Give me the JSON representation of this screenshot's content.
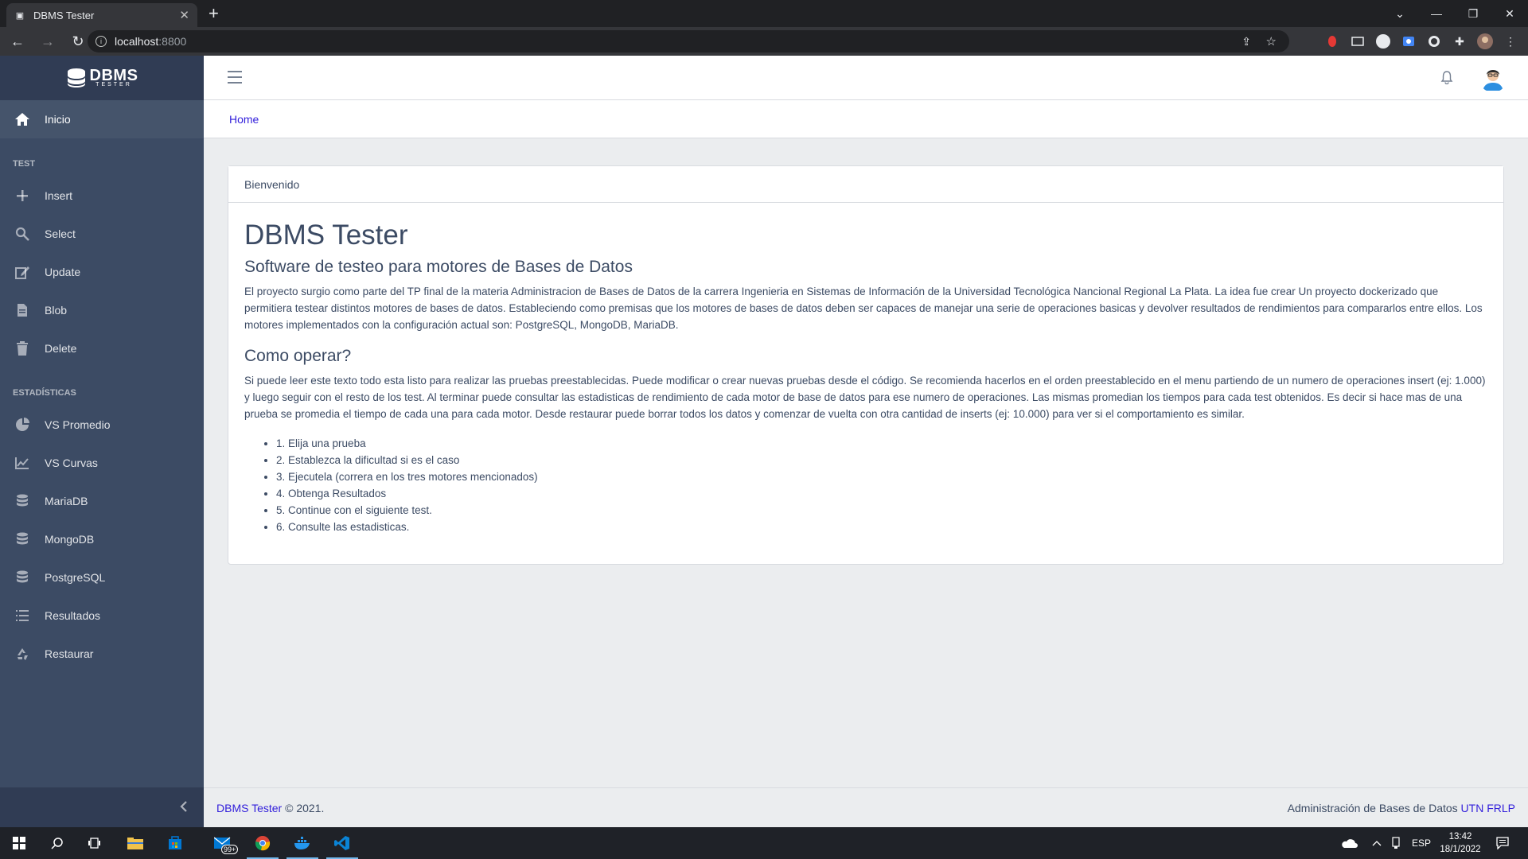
{
  "browser": {
    "tab_title": "DBMS Tester",
    "url_host": "localhost",
    "url_port": ":8800"
  },
  "brand": {
    "name": "DBMS",
    "sub": "TESTER"
  },
  "sidebar": {
    "home": "Inicio",
    "section_test": "TEST",
    "test_items": [
      "Insert",
      "Select",
      "Update",
      "Blob",
      "Delete"
    ],
    "section_stats": "ESTADÍSTICAS",
    "stats_items": [
      "VS Promedio",
      "VS Curvas",
      "MariaDB",
      "MongoDB",
      "PostgreSQL",
      "Resultados",
      "Restaurar"
    ]
  },
  "breadcrumb": {
    "home": "Home"
  },
  "card": {
    "header": "Bienvenido",
    "title": "DBMS Tester",
    "subtitle": "Software de testeo para motores de Bases de Datos",
    "intro": "El proyecto surgio como parte del TP final de la materia Administracion de Bases de Datos de la carrera Ingenieria en Sistemas de Información de la Universidad Tecnológica Nancional Regional La Plata. La idea fue crear Un proyecto dockerizado que permitiera testear distintos motores de bases de datos. Estableciendo como premisas que los motores de bases de datos deben ser capaces de manejar una serie de operaciones basicas y devolver resultados de rendimientos para compararlos entre ellos. Los motores implementados con la configuración actual son: PostgreSQL, MongoDB, MariaDB.",
    "how_title": "Como operar?",
    "how_text": "Si puede leer este texto todo esta listo para realizar las pruebas preestablecidas. Puede modificar o crear nuevas pruebas desde el código. Se recomienda hacerlos en el orden preestablecido en el menu partiendo de un numero de operaciones insert (ej: 1.000) y luego seguir con el resto de los test. Al terminar puede consultar las estadisticas de rendimiento de cada motor de base de datos para ese numero de operaciones. Las mismas promedian los tiempos para cada test obtenidos. Es decir si hace mas de una prueba se promedia el tiempo de cada una para cada motor. Desde restaurar puede borrar todos los datos y comenzar de vuelta con otra cantidad de inserts (ej: 10.000) para ver si el comportamiento es similar.",
    "steps": [
      "1. Elija una prueba",
      "2. Establezca la dificultad si es el caso",
      "3. Ejecutela (correra en los tres motores mencionados)",
      "4. Obtenga Resultados",
      "5. Continue con el siguiente test.",
      "6. Consulte las estadisticas."
    ]
  },
  "footer": {
    "brand_link": "DBMS Tester",
    "copyright": " © 2021.",
    "right_text": "Administración de Bases de Datos ",
    "right_link": "UTN FRLP"
  },
  "taskbar": {
    "mail_badge": "99+",
    "lang": "ESP",
    "time": "13:42",
    "date": "18/1/2022"
  },
  "colors": {
    "sidebar": "#3c4b64",
    "link": "#321fdb",
    "background": "#ebedef"
  }
}
